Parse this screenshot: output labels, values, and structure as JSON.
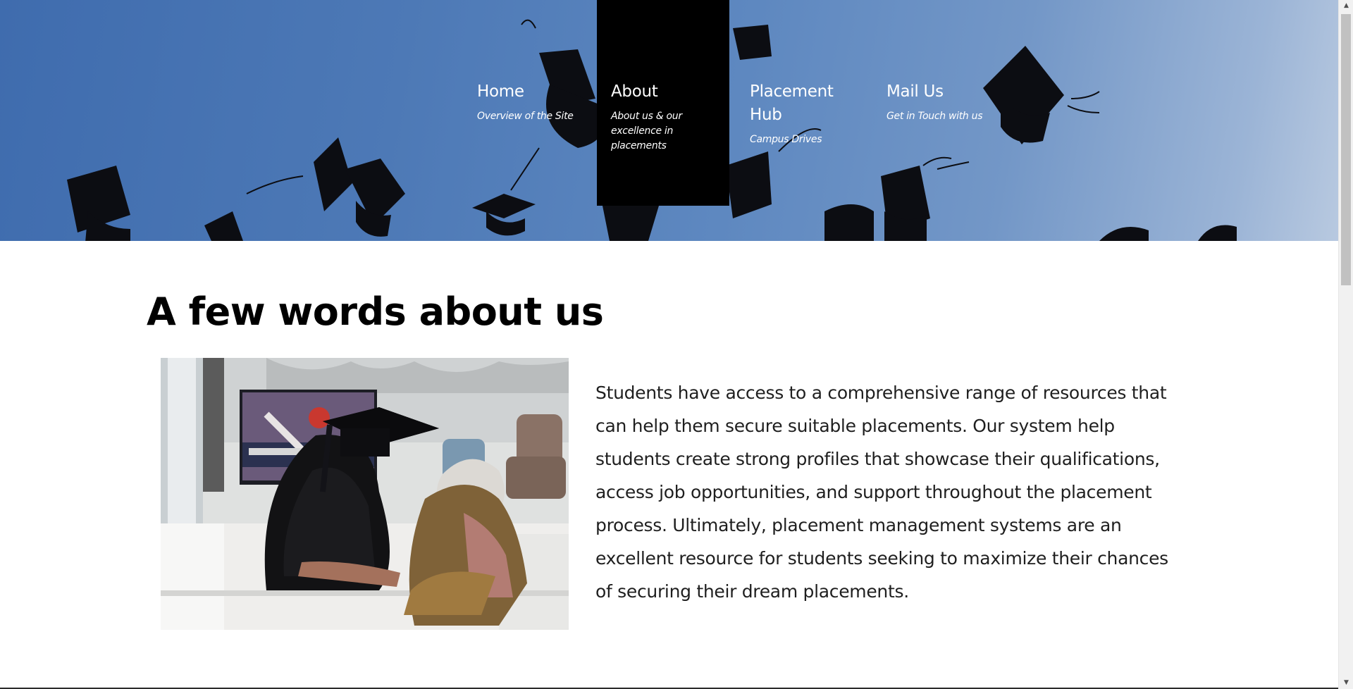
{
  "nav": {
    "items": [
      {
        "title": "Home",
        "subtitle": "Overview of the Site"
      },
      {
        "title": "About",
        "subtitle": "About us & our excellence in placements"
      },
      {
        "title": "Placement Hub",
        "subtitle": "Campus Drives"
      },
      {
        "title": "Mail Us",
        "subtitle": "Get in Touch with us"
      }
    ],
    "active_index": 1
  },
  "main": {
    "heading": "A few words about us",
    "body": "Students have access to a comprehensive range of resources that can help them secure suitable placements. Our system help students create strong profiles that showcase their qualifications, access job opportunities, and support throughout the placement process. Ultimately, placement management systems are an excellent resource for students seeking to maximize their chances of securing their dream placements."
  },
  "scrollbar": {
    "up_icon": "scroll-up-arrow",
    "down_icon": "scroll-down-arrow"
  }
}
